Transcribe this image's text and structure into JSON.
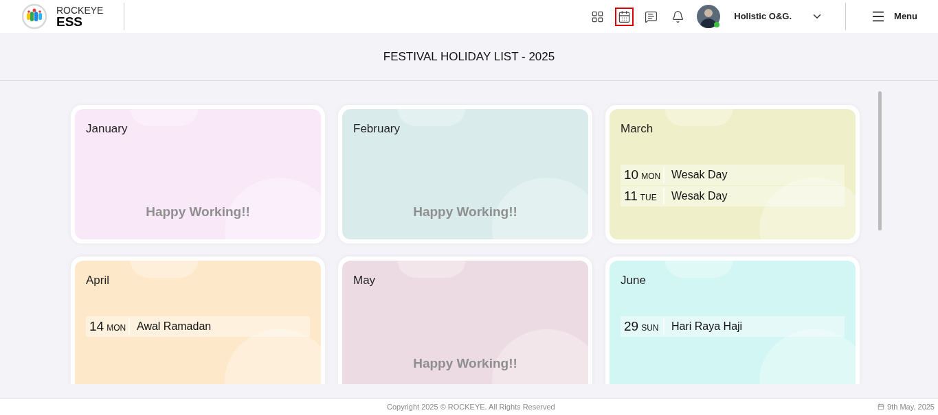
{
  "brand": {
    "line1": "ROCKEYE",
    "line2": "ESS"
  },
  "nav_icons": [
    {
      "kind": "apps",
      "selected": false
    },
    {
      "kind": "calendar",
      "selected": true
    },
    {
      "kind": "chat",
      "selected": false
    },
    {
      "kind": "bell",
      "selected": false
    }
  ],
  "user": {
    "name": "Holistic O&G.",
    "online": true
  },
  "menu": "Menu",
  "page_title": "FESTIVAL HOLIDAY LIST - 2025",
  "months": [
    {
      "name": "January",
      "color": "#f8e8f8",
      "empty_text": "Happy Working!!"
    },
    {
      "name": "February",
      "color": "#d9ebeb",
      "empty_text": "Happy Working!!"
    },
    {
      "name": "March",
      "color": "#eff0c9",
      "holidays": [
        {
          "day": "10",
          "weekday": "MON",
          "name": "Wesak Day"
        },
        {
          "day": "11",
          "weekday": "TUE",
          "name": "Wesak Day"
        }
      ]
    },
    {
      "name": "April",
      "color": "#fde9ca",
      "holidays": [
        {
          "day": "14",
          "weekday": "MON",
          "name": "Awal Ramadan"
        }
      ]
    },
    {
      "name": "May",
      "color": "#ecdbe3",
      "empty_text": "Happy Working!!"
    },
    {
      "name": "June",
      "color": "#d2f6f3",
      "holidays": [
        {
          "day": "29",
          "weekday": "SUN",
          "name": "Hari Raya Haji"
        }
      ]
    }
  ],
  "footer": {
    "copyright": "Copyright 2025 © ROCKEYE. All Rights Reserved",
    "date": "9th May, 2025"
  }
}
